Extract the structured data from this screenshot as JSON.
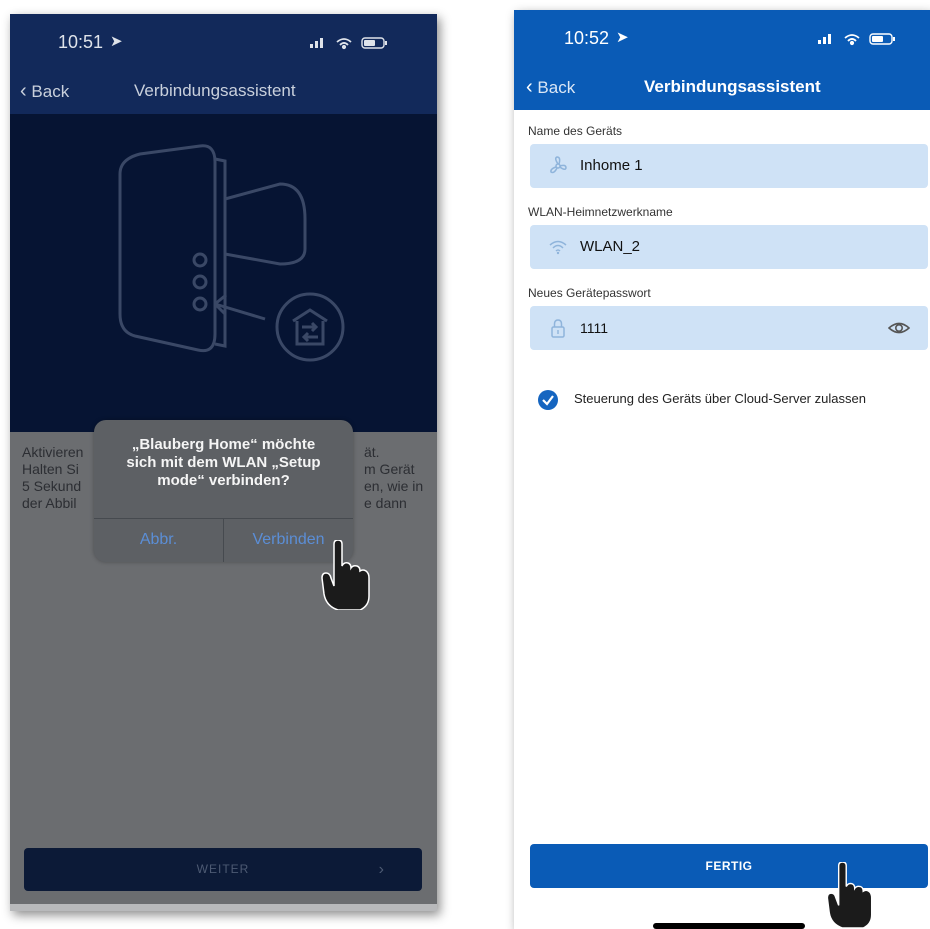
{
  "left_screen": {
    "status": {
      "time": "10:51"
    },
    "nav": {
      "back_label": "Back",
      "title": "Verbindungsassistent"
    },
    "instruction_lines": [
      "Aktivieren",
      "Halten Si",
      "5 Sekund",
      "der Abbil"
    ],
    "instruction_right_lines": [
      "ät.",
      "m Gerät",
      "en, wie in",
      "e dann"
    ],
    "dialog": {
      "message_lines": [
        "„Blauberg Home“ möchte",
        "sich mit dem WLAN „Setup",
        "mode“ verbinden?"
      ],
      "cancel_label": "Abbr.",
      "confirm_label": "Verbinden"
    },
    "weiter_label": "WEITER",
    "colors": {
      "header": "#12295a",
      "hero": "#061433",
      "dim": "#6b6d70",
      "accent": "#5b8ed6"
    }
  },
  "right_screen": {
    "status": {
      "time": "10:52"
    },
    "nav": {
      "back_label": "Back",
      "title": "Verbindungsassistent"
    },
    "fields": [
      {
        "label": "Name des Geräts",
        "value": "Inhome 1",
        "icon": "fan-icon"
      },
      {
        "label": "WLAN-Heimnetzwerkname",
        "value": "WLAN_2",
        "icon": "wifi-icon"
      },
      {
        "label": "Neues Gerätepasswort",
        "value": "1111",
        "icon": "lock-icon",
        "trailing_icon": "eye-icon"
      }
    ],
    "cloud_checkbox": {
      "label": "Steuerung des Geräts über Cloud-Server zulassen",
      "checked": true
    },
    "fertig_label": "FERTIG",
    "colors": {
      "header": "#0a5bb6",
      "field_bg": "#cfe2f6",
      "accent": "#1565c0"
    }
  }
}
